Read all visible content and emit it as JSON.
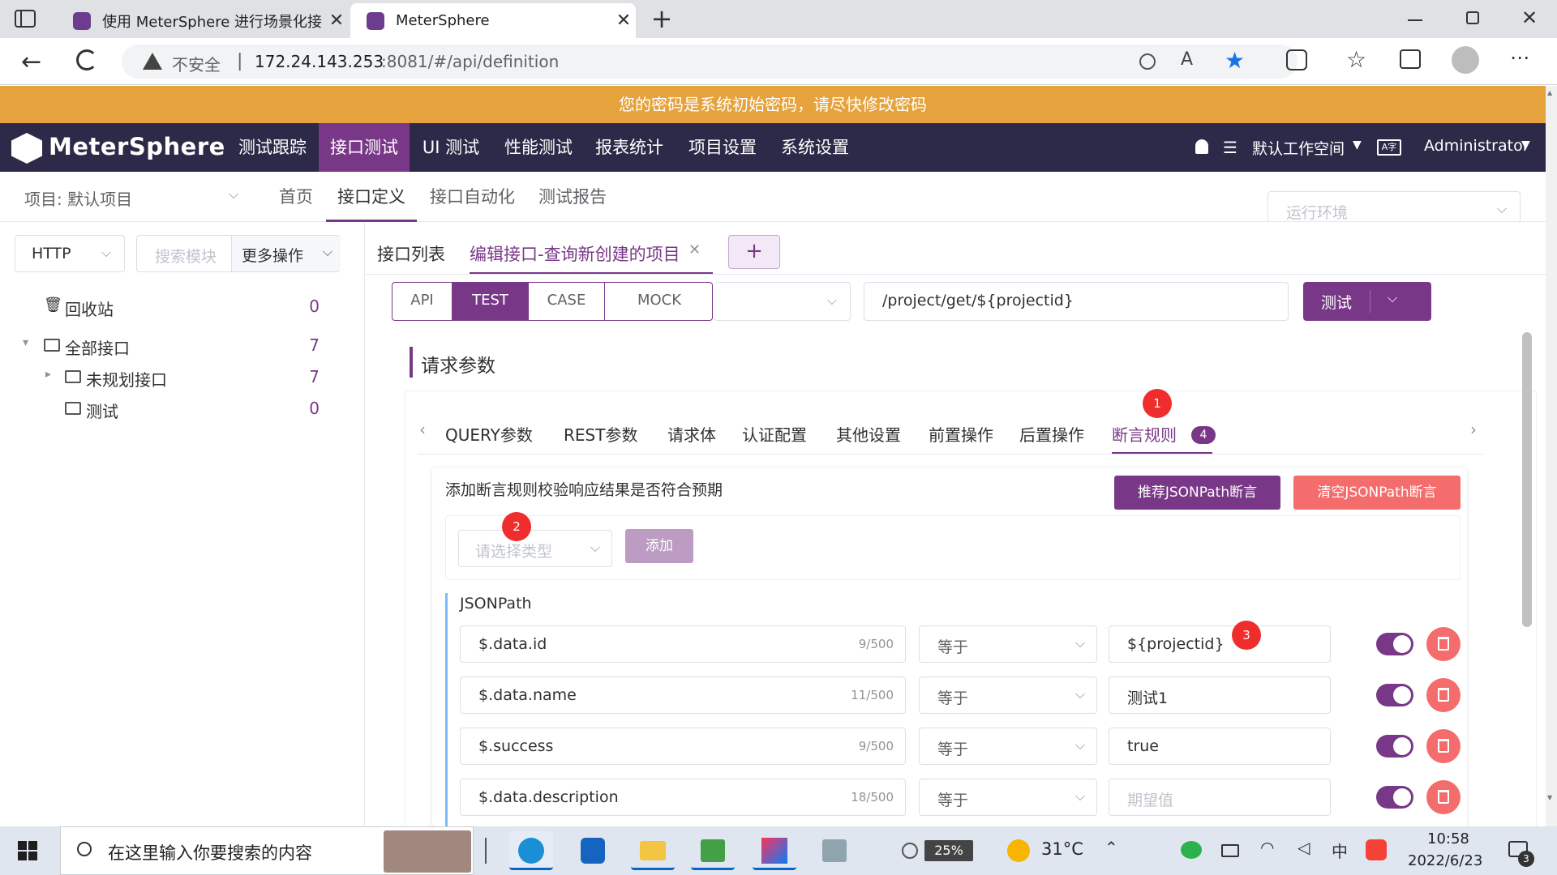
{
  "browser": {
    "tabs": [
      {
        "title": "使用 MeterSphere 进行场景化接",
        "active": false
      },
      {
        "title": "MeterSphere",
        "active": true
      }
    ],
    "security": "不安全",
    "url_host": "172.24.143.253",
    "url_rest": ":8081/#/api/definition"
  },
  "banner": "您的密码是系统初始密码，请尽快修改密码",
  "topnav": {
    "logo": "MeterSphere",
    "items": [
      "测试跟踪",
      "接口测试",
      "UI 测试",
      "性能测试",
      "报表统计",
      "项目设置",
      "系统设置"
    ],
    "active_index": 1,
    "workspace": "默认工作空间",
    "user": "Administrator"
  },
  "subnav": {
    "project": "项目: 默认项目",
    "items": [
      "首页",
      "接口定义",
      "接口自动化",
      "测试报告"
    ],
    "active_index": 1,
    "env_placeholder": "运行环境"
  },
  "left": {
    "protocol": "HTTP",
    "search_placeholder": "搜索模块",
    "more_ops": "更多操作",
    "tree": [
      {
        "label": "回收站",
        "count": "0"
      },
      {
        "label": "全部接口",
        "count": "7"
      },
      {
        "label": "未规划接口",
        "count": "7"
      },
      {
        "label": "测试",
        "count": "0"
      }
    ]
  },
  "editor": {
    "tabs": [
      "接口列表",
      "编辑接口-查询新创建的项目"
    ],
    "add_tab": "+",
    "modes": [
      "API",
      "TEST",
      "CASE",
      "MOCK"
    ],
    "active_mode": 1,
    "url": "/project/get/${projectid}",
    "test_button": "测试",
    "section_title": "请求参数",
    "param_tabs": [
      "QUERY参数",
      "REST参数",
      "请求体",
      "认证配置",
      "其他设置",
      "前置操作",
      "后置操作",
      "断言规则"
    ],
    "assert_count": "4",
    "assert_desc": "添加断言规则校验响应结果是否符合预期",
    "recommend_btn": "推荐JSONPath断言",
    "clear_btn": "清空JSONPath断言",
    "type_placeholder": "请选择类型",
    "add_btn": "添加",
    "jsonpath_title": "JSONPath",
    "rows": [
      {
        "expr": "$.data.id",
        "len": "9/500",
        "op": "等于",
        "value": "${projectid}",
        "placeholder": ""
      },
      {
        "expr": "$.data.name",
        "len": "11/500",
        "op": "等于",
        "value": "测试1",
        "placeholder": ""
      },
      {
        "expr": "$.success",
        "len": "9/500",
        "op": "等于",
        "value": "true",
        "placeholder": ""
      },
      {
        "expr": "$.data.description",
        "len": "18/500",
        "op": "等于",
        "value": "",
        "placeholder": "期望值"
      }
    ],
    "annotations": [
      "1",
      "2",
      "3"
    ]
  },
  "taskbar": {
    "search_placeholder": "在这里输入你要搜索的内容",
    "battery": "25%",
    "weather": "31°C",
    "ime": "中",
    "time": "10:58",
    "date": "2022/6/23",
    "notify_count": "3"
  },
  "colors": {
    "brand": "#783887",
    "nav_bg": "#2c2a48",
    "banner": "#e6a23c",
    "danger": "#f56c6c",
    "annotation": "#f02d2d"
  }
}
